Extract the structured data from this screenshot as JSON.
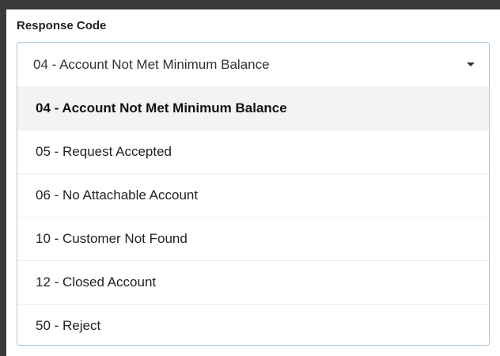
{
  "field": {
    "label": "Response Code",
    "selected_value": "04 - Account Not Met Minimum Balance",
    "caret_icon": "caret-down-icon"
  },
  "options": [
    {
      "label": "04 - Account Not Met Minimum Balance",
      "selected": true
    },
    {
      "label": "05 - Request Accepted",
      "selected": false
    },
    {
      "label": "06 - No Attachable Account",
      "selected": false
    },
    {
      "label": "10 - Customer Not Found",
      "selected": false
    },
    {
      "label": "12 - Closed Account",
      "selected": false
    },
    {
      "label": "50 - Reject",
      "selected": false
    }
  ]
}
